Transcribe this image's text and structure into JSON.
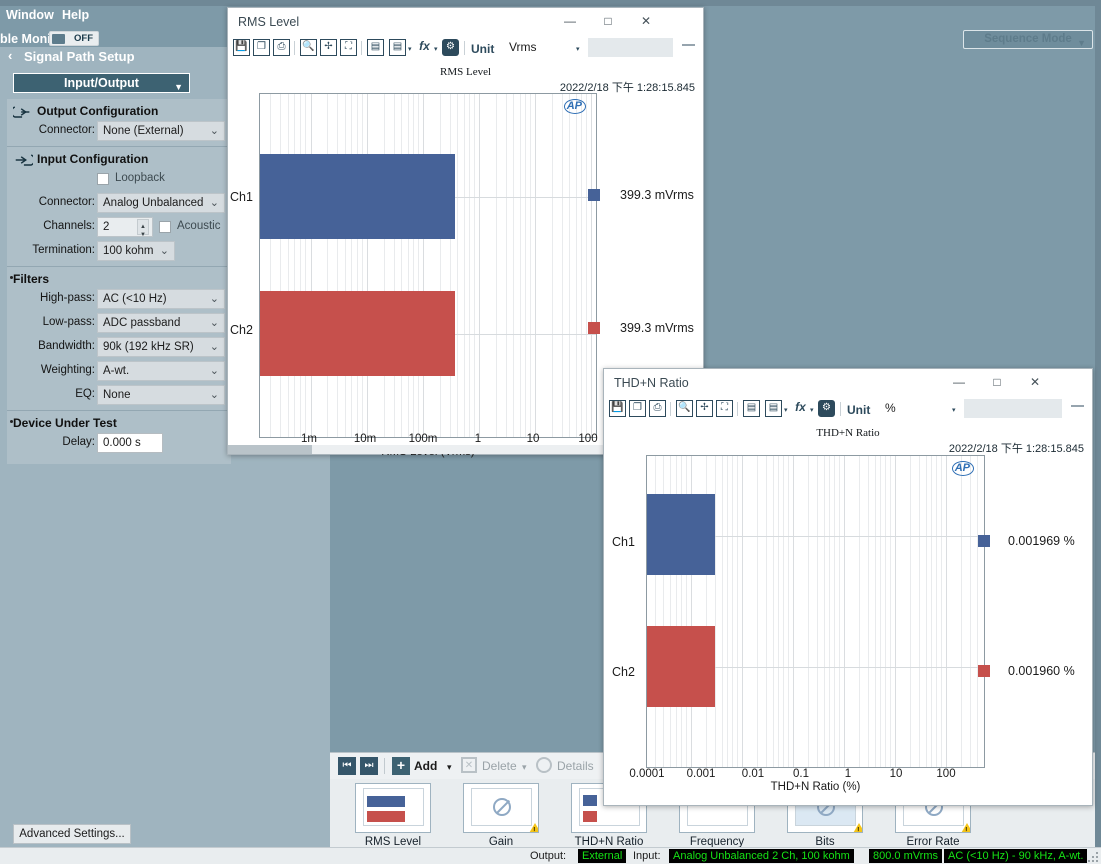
{
  "app": {
    "menu": [
      {
        "label": "Window"
      },
      {
        "label": "Help"
      }
    ],
    "monitor": {
      "label": "ble Monitor",
      "state": "OFF"
    },
    "sequence_mode": {
      "label": "Sequence Mode",
      "caret": "▼"
    }
  },
  "sidebar": {
    "back_icon": "‹",
    "title": "Signal Path Setup",
    "page_selector": {
      "label": "Input/Output",
      "caret": "▼"
    },
    "sections": [
      {
        "title": "Output Configuration",
        "icon": "output-arrow-icon",
        "rows": [
          {
            "label": "Connector:",
            "value": "None (External)",
            "type": "select"
          }
        ]
      },
      {
        "title": "Input Configuration",
        "icon": "input-arrow-icon",
        "rows": [
          {
            "label": "",
            "value": "Loopback",
            "type": "checkbox",
            "checked": false
          },
          {
            "label": "Connector:",
            "value": "Analog Unbalanced",
            "type": "select"
          },
          {
            "label": "Channels:",
            "value": "2",
            "type": "spinner",
            "extra_checkbox": "Acoustic"
          },
          {
            "label": "Termination:",
            "value": "100 kohm",
            "type": "select-narrow"
          }
        ]
      },
      {
        "title": "Filters",
        "icon": "bullet",
        "rows": [
          {
            "label": "High-pass:",
            "value": "AC (<10 Hz)",
            "type": "select"
          },
          {
            "label": "Low-pass:",
            "value": "ADC passband",
            "type": "select"
          },
          {
            "label": "Bandwidth:",
            "value": "90k (192 kHz SR)",
            "type": "select"
          },
          {
            "label": "Weighting:",
            "value": "A-wt.",
            "type": "select"
          },
          {
            "label": "EQ:",
            "value": "None",
            "type": "select"
          }
        ]
      },
      {
        "title": "Device Under Test",
        "icon": "bullet",
        "rows": [
          {
            "label": "Delay:",
            "value": "0.000 s",
            "type": "text"
          }
        ]
      }
    ],
    "advanced_settings": "Advanced Settings..."
  },
  "measurement_strip": {
    "toolbar": {
      "prev": "⏮",
      "next": "⏭",
      "add": "Add",
      "add_caret": "▾",
      "delete": "Delete",
      "delete_caret": "▾",
      "details": "Details"
    },
    "tiles": [
      {
        "label": "RMS Level",
        "kind": "bars",
        "warning": false
      },
      {
        "label": "Gain",
        "kind": "blocked",
        "warning": true
      },
      {
        "label": "THD+N Ratio",
        "kind": "bars-small",
        "warning": false
      },
      {
        "label": "Frequency",
        "kind": "bars",
        "warning": false
      },
      {
        "label": "Bits",
        "kind": "blocked-hist",
        "warning": true
      },
      {
        "label": "Error Rate",
        "kind": "blocked",
        "warning": true
      }
    ]
  },
  "statusbar": {
    "output_label": "Output:",
    "output_value": "External",
    "input_label": "Input:",
    "input_values": [
      "Analog Unbalanced 2 Ch, 100 kohm",
      "800.0 mVrms",
      "AC (<10 Hz) - 90 kHz, A-wt."
    ]
  },
  "windows": [
    {
      "id": "rms",
      "title": "RMS Level",
      "controls": {
        "minimize": "—",
        "maximize": "□",
        "close": "✕"
      },
      "toolbar": {
        "icons": [
          "save-icon",
          "copy-icon",
          "print-icon",
          "zoom-icon",
          "move-icon",
          "fit-icon",
          "table-icon",
          "graph-icon",
          "function-icon",
          "settings-icon"
        ],
        "unit_label": "Unit",
        "unit_value": "Vrms",
        "unit_caret": "▾",
        "corner_icon": "export-icon"
      },
      "chart_data": {
        "type": "bar",
        "orientation": "horizontal",
        "title": "RMS Level",
        "timestamp": "2022/2/18 下午 1:28:15.845",
        "logo": "AP",
        "categories": [
          "Ch1",
          "Ch2"
        ],
        "values": [
          0.3993,
          0.3993
        ],
        "value_labels": [
          "399.3  mVrms",
          "399.3  mVrms"
        ],
        "colors": [
          "#466298",
          "#c6504c"
        ],
        "xlabel": "RMS Level (Vrms)",
        "ylabel": "",
        "xticks": [
          "1m",
          "10m",
          "100m",
          "1",
          "10",
          "100"
        ],
        "xscale": "log",
        "xlim": [
          0.0003,
          300
        ],
        "grid": true,
        "legend": "right"
      }
    },
    {
      "id": "thdn",
      "title": "THD+N Ratio",
      "controls": {
        "minimize": "—",
        "maximize": "□",
        "close": "✕"
      },
      "toolbar": {
        "icons": [
          "save-icon",
          "copy-icon",
          "print-icon",
          "zoom-icon",
          "move-icon",
          "fit-icon",
          "table-icon",
          "graph-icon",
          "function-icon",
          "settings-icon"
        ],
        "unit_label": "Unit",
        "unit_value": "%",
        "unit_caret": "▾",
        "corner_icon": "export-icon"
      },
      "chart_data": {
        "type": "bar",
        "orientation": "horizontal",
        "title": "THD+N Ratio",
        "timestamp": "2022/2/18 下午 1:28:15.845",
        "logo": "AP",
        "categories": [
          "Ch1",
          "Ch2"
        ],
        "values": [
          0.001969,
          0.00196
        ],
        "value_labels": [
          "0.001969 %",
          "0.001960 %"
        ],
        "colors": [
          "#466298",
          "#c6504c"
        ],
        "xlabel": "THD+N Ratio (%)",
        "ylabel": "",
        "xticks": [
          "0.0001",
          "0.001",
          "0.01",
          "0.1",
          "1",
          "10",
          "100"
        ],
        "xscale": "log",
        "xlim": [
          5e-05,
          200
        ],
        "grid": true,
        "legend": "right"
      }
    }
  ]
}
